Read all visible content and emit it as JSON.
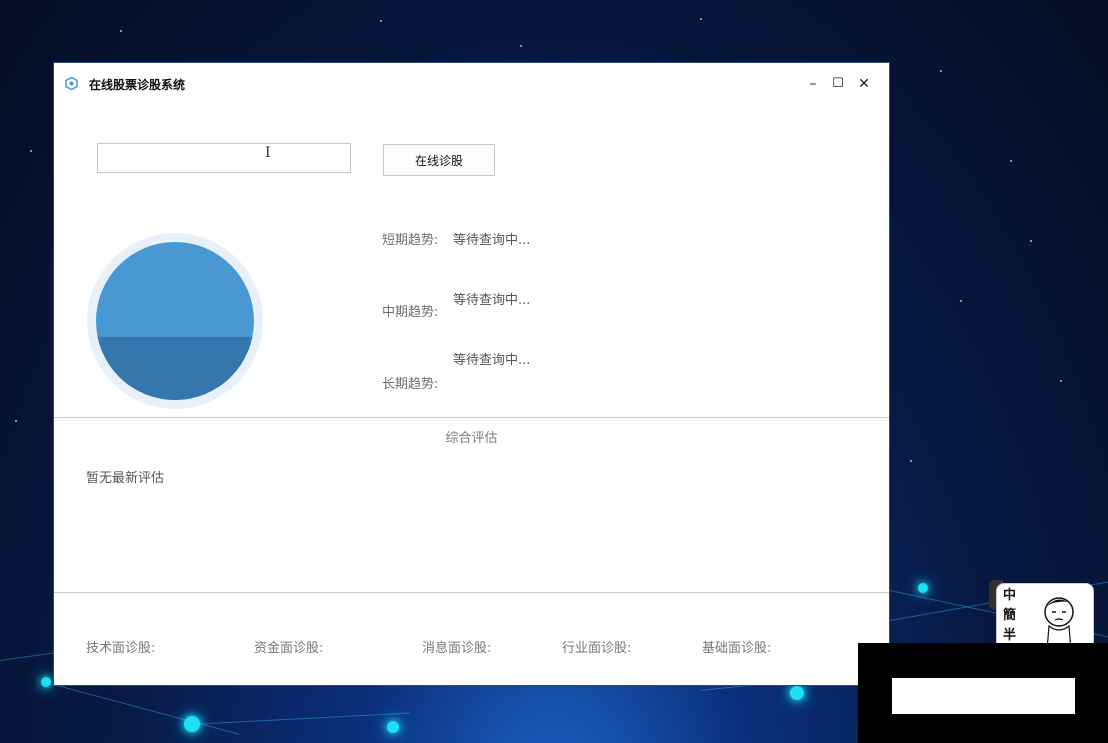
{
  "window": {
    "title": "在线股票诊股系统",
    "controls": {
      "minimize": "–",
      "maximize": "☐",
      "close": "✕"
    }
  },
  "search": {
    "value": "",
    "placeholder": "",
    "button_label": "在线诊股"
  },
  "trends": [
    {
      "label": "短期趋势:",
      "value": "等待查询中..."
    },
    {
      "label": "中期趋势:",
      "value": "等待查询中..."
    },
    {
      "label": "长期趋势:",
      "value": "等待查询中..."
    }
  ],
  "gauge": {
    "fill_fraction": 0.4,
    "colors": {
      "top": "#4a98d1",
      "bottom": "#3577ac",
      "ring": "#e8f1f9"
    }
  },
  "evaluation": {
    "title": "综合评估",
    "text": "暂无最新评估"
  },
  "diagnosis": [
    {
      "label": "技术面诊股:"
    },
    {
      "label": "资金面诊股:"
    },
    {
      "label": "消息面诊股:"
    },
    {
      "label": "行业面诊股:"
    },
    {
      "label": "基础面诊股:"
    }
  ],
  "sticker": {
    "text": "中簡半"
  },
  "colors": {
    "accent": "#4a98d1",
    "window_bg": "#ffffff",
    "desktop": "#071a45"
  }
}
